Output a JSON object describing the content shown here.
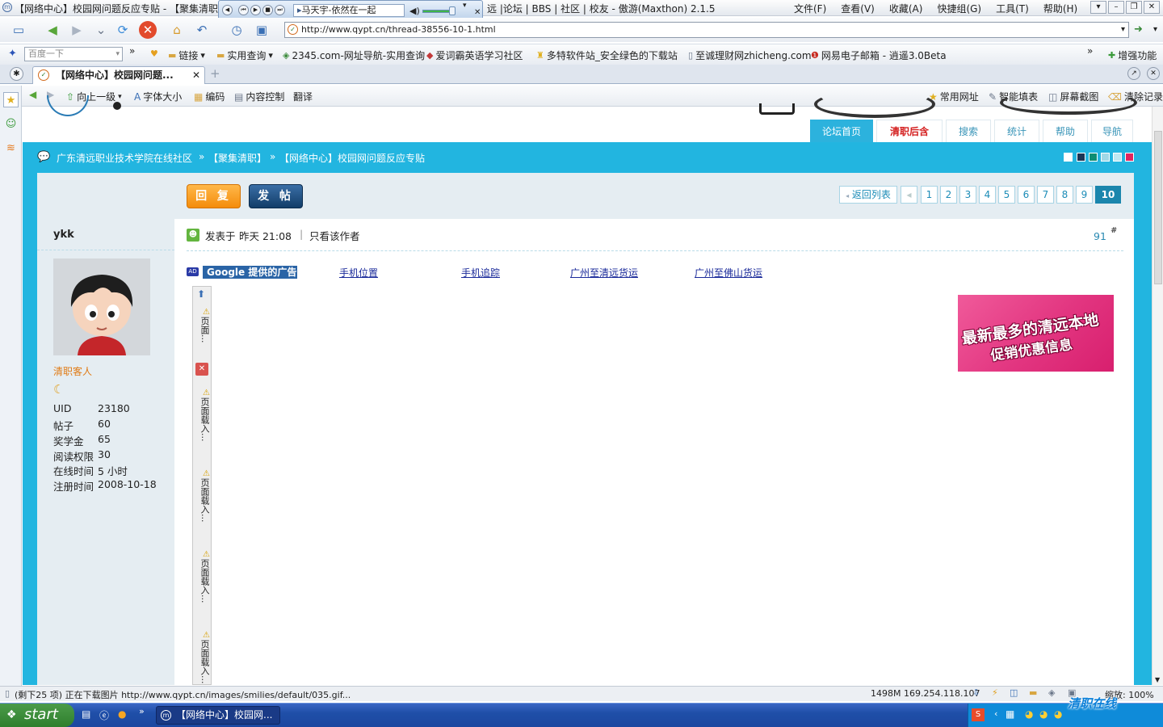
{
  "window": {
    "title": "【网络中心】校园网问题反应专贴 - 【聚集清职",
    "title_rest": "远 |论坛 | BBS | 社区 | 校友 - 傲游(Maxthon) 2.1.5",
    "menu": [
      "文件(F)",
      "查看(V)",
      "收藏(A)",
      "快捷组(G)",
      "工具(T)",
      "帮助(H)"
    ]
  },
  "player": {
    "song": "马天宇-依然在一起"
  },
  "address": {
    "url": "http://www.qypt.cn/thread-38556-10-1.html"
  },
  "bookmarks": {
    "search_placeholder": "百度一下",
    "items": [
      "链接",
      "实用查询",
      "2345.com-网址导航-实用查询",
      "爱词霸英语学习社区",
      "多特软件站_安全绿色的下载站",
      "至诚理财网zhicheng.com",
      "网易电子邮箱 - 逍遥3.0Beta"
    ],
    "more": "增强功能"
  },
  "tab": {
    "label": "【网络中心】校园网问题..."
  },
  "subtoolbar": {
    "items": [
      "向上一级",
      "字体大小",
      "编码",
      "内容控制",
      "翻译"
    ],
    "right_items": [
      "常用网址",
      "智能填表",
      "屏幕截图",
      "清除记录"
    ]
  },
  "forum": {
    "nav_tabs": [
      "论坛首页",
      "清职后含",
      "搜索",
      "统计",
      "帮助",
      "导航"
    ],
    "breadcrumb": [
      "广东清远职业技术学院在线社区",
      "【聚集清职】",
      "【网络中心】校园网问题反应专贴"
    ],
    "breadcrumb_sep": "»",
    "style_colors": [
      "#ffffff",
      "#1c3556",
      "#0e8d73",
      "#9fd8e6",
      "#bfe8f2",
      "#e0245e"
    ],
    "reply_label": "回 复",
    "post_label": "发 帖",
    "back_label": "返回列表",
    "pages": [
      "1",
      "2",
      "3",
      "4",
      "5",
      "6",
      "7",
      "8",
      "9",
      "10"
    ],
    "current_page": "10"
  },
  "user": {
    "name": "ykk",
    "group": "清职客人",
    "stats": [
      {
        "label": "UID",
        "value": "23180"
      },
      {
        "label": "帖子",
        "value": "60"
      },
      {
        "label": "奖学金",
        "value": "65"
      },
      {
        "label": "阅读权限",
        "value": "30"
      },
      {
        "label": "在线时间",
        "value": "5 小时"
      },
      {
        "label": "注册时间",
        "value": "2008-10-18"
      }
    ]
  },
  "post": {
    "posted_label": "发表于",
    "time": "昨天 21:08",
    "author_only": "只看该作者",
    "floor": "91",
    "floor_mark": "#"
  },
  "ads": {
    "google": "Google 提供的广告",
    "links": [
      "手机位置",
      "手机追踪",
      "广州至清远货运",
      "广州至佛山货运"
    ],
    "loading_first": "页面...",
    "loading": "页面载入...",
    "promo_line1": "最新最多的清远本地",
    "promo_line2": "促销优惠信息"
  },
  "status": {
    "text": "(剩下25 项) 正在下载图片 http://www.qypt.cn/images/smilies/default/035.gif...",
    "memory": "1498M 169.254.118.107",
    "zoom": "缩放: 100%"
  },
  "taskbar": {
    "start": "start",
    "task": "【网络中心】校园网...",
    "watermark": "清职在线"
  }
}
